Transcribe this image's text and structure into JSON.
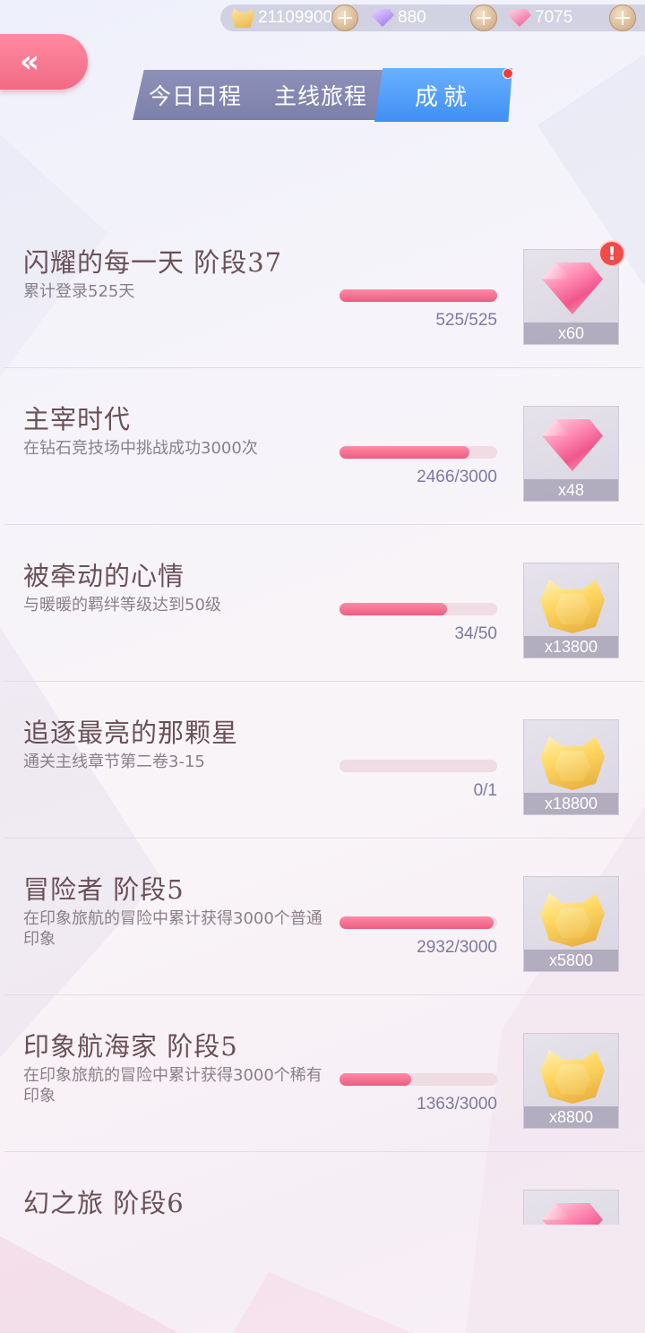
{
  "currencies": [
    {
      "icon": "gold-cat-coin-icon",
      "value": "21109900"
    },
    {
      "icon": "purple-gem-icon",
      "value": "880"
    },
    {
      "icon": "pink-gem-icon",
      "value": "7075"
    }
  ],
  "back_label": "«",
  "tabs": [
    {
      "label": "今日日程",
      "active": false
    },
    {
      "label": "主线旅程",
      "active": false
    },
    {
      "label": "成就",
      "active": true
    }
  ],
  "achievements": [
    {
      "title": "闪耀的每一天 阶段37",
      "desc": "累计登录525天",
      "progress_text": "525/525",
      "progress": 1.0,
      "reward": "gem",
      "reward_count": "x60",
      "alert": "!"
    },
    {
      "title": "主宰时代",
      "desc": "在钻石竞技场中挑战成功3000次",
      "progress_text": "2466/3000",
      "progress": 0.822,
      "reward": "gem",
      "reward_count": "x48"
    },
    {
      "title": "被牵动的心情",
      "desc": "与暖暖的羁绊等级达到50级",
      "progress_text": "34/50",
      "progress": 0.68,
      "reward": "coin",
      "reward_count": "x13800"
    },
    {
      "title": "追逐最亮的那颗星",
      "desc": "通关主线章节第二卷3-15",
      "progress_text": "0/1",
      "progress": 0.0,
      "reward": "coin",
      "reward_count": "x18800"
    },
    {
      "title": "冒险者 阶段5",
      "desc": "在印象旅航的冒险中累计获得3000个普通印象",
      "progress_text": "2932/3000",
      "progress": 0.977,
      "reward": "coin",
      "reward_count": "x5800"
    },
    {
      "title": "印象航海家 阶段5",
      "desc": "在印象旅航的冒险中累计获得3000个稀有印象",
      "progress_text": "1363/3000",
      "progress": 0.454,
      "reward": "coin",
      "reward_count": "x8800"
    },
    {
      "title": "幻之旅 阶段6",
      "desc": "",
      "progress_text": "",
      "progress": null,
      "reward": "gem",
      "reward_count": ""
    }
  ],
  "colors": {
    "accent_pink": "#ec5c80",
    "tab_active": "#3f8ff3",
    "tab_bg": "#7d80a8",
    "title_text": "#6a5056"
  }
}
